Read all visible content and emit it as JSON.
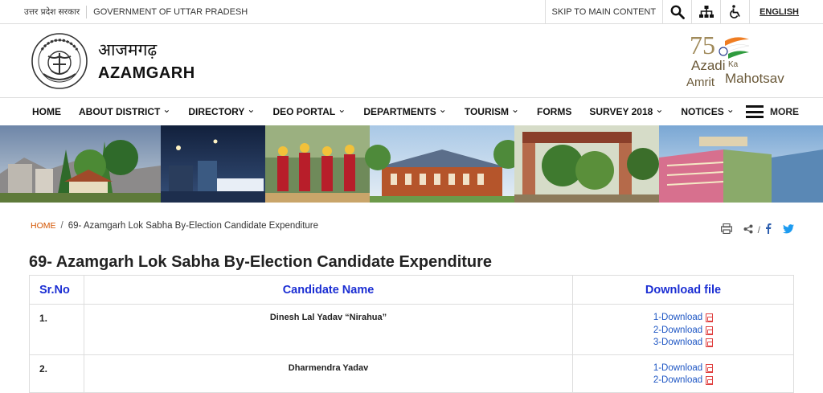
{
  "topbar": {
    "hindi_govt": "उत्तर प्रदेश सरकार",
    "govt": "GOVERNMENT OF UTTAR PRADESH",
    "skip": "SKIP TO MAIN CONTENT",
    "language": "ENGLISH"
  },
  "header": {
    "hindi_name": "आजमगढ़",
    "name": "AZAMGARH",
    "emblem_text": "उत्तर प्रदेश सरकार",
    "azadi": {
      "number": "75",
      "line1": "Azadi",
      "ka": "Ka",
      "line2": "Amrit",
      "line3": "Mahotsav"
    }
  },
  "nav": {
    "items": [
      {
        "label": "HOME",
        "dropdown": false
      },
      {
        "label": "ABOUT DISTRICT",
        "dropdown": true
      },
      {
        "label": "DIRECTORY",
        "dropdown": true
      },
      {
        "label": "DEO PORTAL",
        "dropdown": true
      },
      {
        "label": "DEPARTMENTS",
        "dropdown": true
      },
      {
        "label": "TOURISM",
        "dropdown": true
      },
      {
        "label": "FORMS",
        "dropdown": false
      },
      {
        "label": "SURVEY 2018",
        "dropdown": true
      },
      {
        "label": "NOTICES",
        "dropdown": true
      }
    ],
    "more": "MORE"
  },
  "breadcrumb": {
    "home": "HOME",
    "separator": "/",
    "current": "69- Azamgarh Lok Sabha By-Election Candidate Expenditure"
  },
  "page_title": "69- Azamgarh Lok Sabha By-Election Candidate Expenditure",
  "table": {
    "headers": [
      "Sr.No",
      "Candidate Name",
      "Download file"
    ],
    "rows": [
      {
        "sr": "1.",
        "name": "Dinesh Lal Yadav “Nirahua”",
        "downloads": [
          "1-Download",
          "2-Download",
          "3-Download"
        ]
      },
      {
        "sr": "2.",
        "name": "Dharmendra Yadav",
        "downloads": [
          "1-Download",
          "2-Download"
        ]
      }
    ]
  },
  "colors": {
    "link": "#1e56c4",
    "header_blue": "#1b2ed3",
    "home_orange": "#d35400",
    "pdf_red": "#e04040"
  }
}
